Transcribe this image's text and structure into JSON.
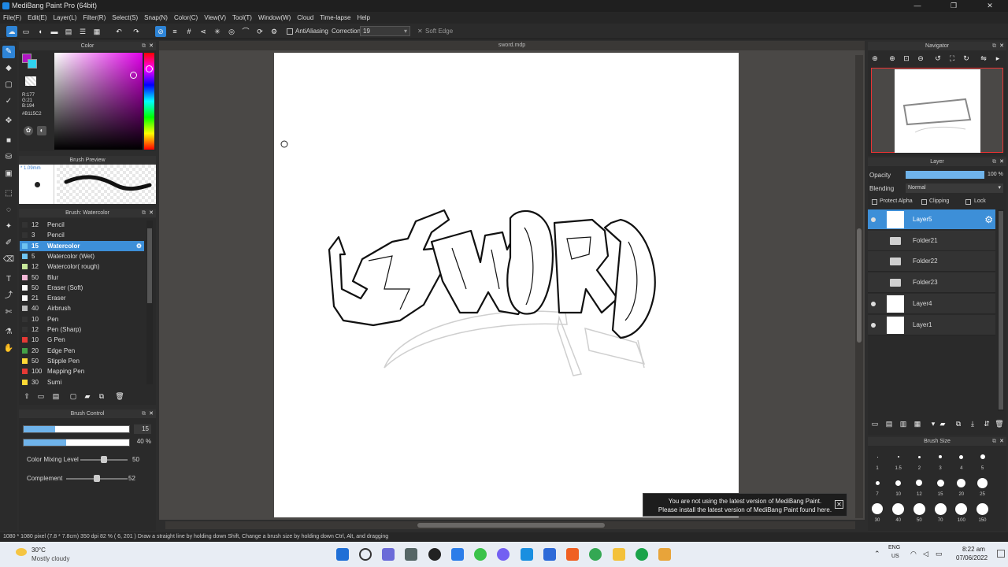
{
  "window": {
    "title": "MediBang Paint Pro (64bit)",
    "controls": [
      "—",
      "❐",
      "✕"
    ]
  },
  "menu": [
    "File(F)",
    "Edit(E)",
    "Layer(L)",
    "Filter(R)",
    "Select(S)",
    "Snap(N)",
    "Color(C)",
    "View(V)",
    "Tool(T)",
    "Window(W)",
    "Cloud",
    "Time-lapse",
    "Help"
  ],
  "toolbar": {
    "antialias_label": "AntiAliasing",
    "correction_label": "Correction",
    "correction_value": "19",
    "soft_edge_label": "Soft Edge"
  },
  "color_panel": {
    "title": "Color",
    "r": "R:177",
    "g": "G:21",
    "b": "B:194",
    "hex": "#B115C2",
    "fg_color": "#B115C2",
    "bg_color": "#ffffff"
  },
  "brush_preview": {
    "title": "Brush Preview",
    "size": "* 1.09mm"
  },
  "brush_list": {
    "title": "Brush: Watercolor",
    "items": [
      {
        "size": "12",
        "name": "Pencil",
        "color": "#333333"
      },
      {
        "size": "3",
        "name": "Pencil",
        "color": "#333333"
      },
      {
        "size": "15",
        "name": "Watercolor",
        "color": "#6ec3f2"
      },
      {
        "size": "5",
        "name": "Watercolor (Wet)",
        "color": "#6ec3f2"
      },
      {
        "size": "12",
        "name": "Watercolor( rough)",
        "color": "#c7e89a"
      },
      {
        "size": "50",
        "name": "Blur",
        "color": "#f3b7d6"
      },
      {
        "size": "50",
        "name": "Eraser (Soft)",
        "color": "#ffffff"
      },
      {
        "size": "21",
        "name": "Eraser",
        "color": "#ffffff"
      },
      {
        "size": "40",
        "name": "Airbrush",
        "color": "#bbbbbb"
      },
      {
        "size": "10",
        "name": "Pen",
        "color": "#333333"
      },
      {
        "size": "12",
        "name": "Pen (Sharp)",
        "color": "#333333"
      },
      {
        "size": "10",
        "name": "G Pen",
        "color": "#e53935"
      },
      {
        "size": "20",
        "name": "Edge Pen",
        "color": "#43a047"
      },
      {
        "size": "50",
        "name": "Stipple Pen",
        "color": "#fdd835"
      },
      {
        "size": "100",
        "name": "Mapping Pen",
        "color": "#e53935"
      },
      {
        "size": "30",
        "name": "Sumi",
        "color": "#fdd835"
      }
    ]
  },
  "brush_control": {
    "title": "Brush Control",
    "size_value": "15",
    "size_level": 0.3,
    "opacity_value": "40 %",
    "opacity_level": 0.4,
    "mixing_label": "Color Mixing Level",
    "mixing_value": "50",
    "complement_label": "Complement",
    "complement_value": "52"
  },
  "canvas": {
    "tab": "sword.mdp",
    "notice_line1": "You are not using the latest version of MediBang Paint.",
    "notice_line2": "Please install the latest version of MediBang Paint found here."
  },
  "navigator": {
    "title": "Navigator"
  },
  "layer_panel": {
    "title": "Layer",
    "opacity_label": "Opacity",
    "opacity_value": "100 %",
    "blending_label": "Blending",
    "blending_value": "Normal",
    "protect_alpha": "Protect Alpha",
    "clipping": "Clipping",
    "lock": "Lock",
    "layers": [
      {
        "name": "Layer5",
        "kind": "layer"
      },
      {
        "name": "Folder21",
        "kind": "folder"
      },
      {
        "name": "Folder22",
        "kind": "folder"
      },
      {
        "name": "Folder23",
        "kind": "folder"
      },
      {
        "name": "Layer4",
        "kind": "layer"
      },
      {
        "name": "Layer1",
        "kind": "layer"
      }
    ]
  },
  "brush_size": {
    "title": "Brush Size",
    "values": [
      "1",
      "1.5",
      "2",
      "3",
      "4",
      "5",
      "7",
      "10",
      "12",
      "15",
      "20",
      "25",
      "30",
      "40",
      "50",
      "70",
      "100",
      "150"
    ]
  },
  "status": "1080 * 1080 pixel  (7.8 * 7.8cm)  350 dpi  82 %  ( 6, 201 )  Draw a straight line by holding down Shift, Change a brush size by holding down Ctrl, Alt, and dragging",
  "taskbar": {
    "weather_temp": "30°C",
    "weather_desc": "Mostly cloudy",
    "lang1": "ENG",
    "lang2": "US",
    "time": "8:22 am",
    "date": "07/06/2022"
  }
}
